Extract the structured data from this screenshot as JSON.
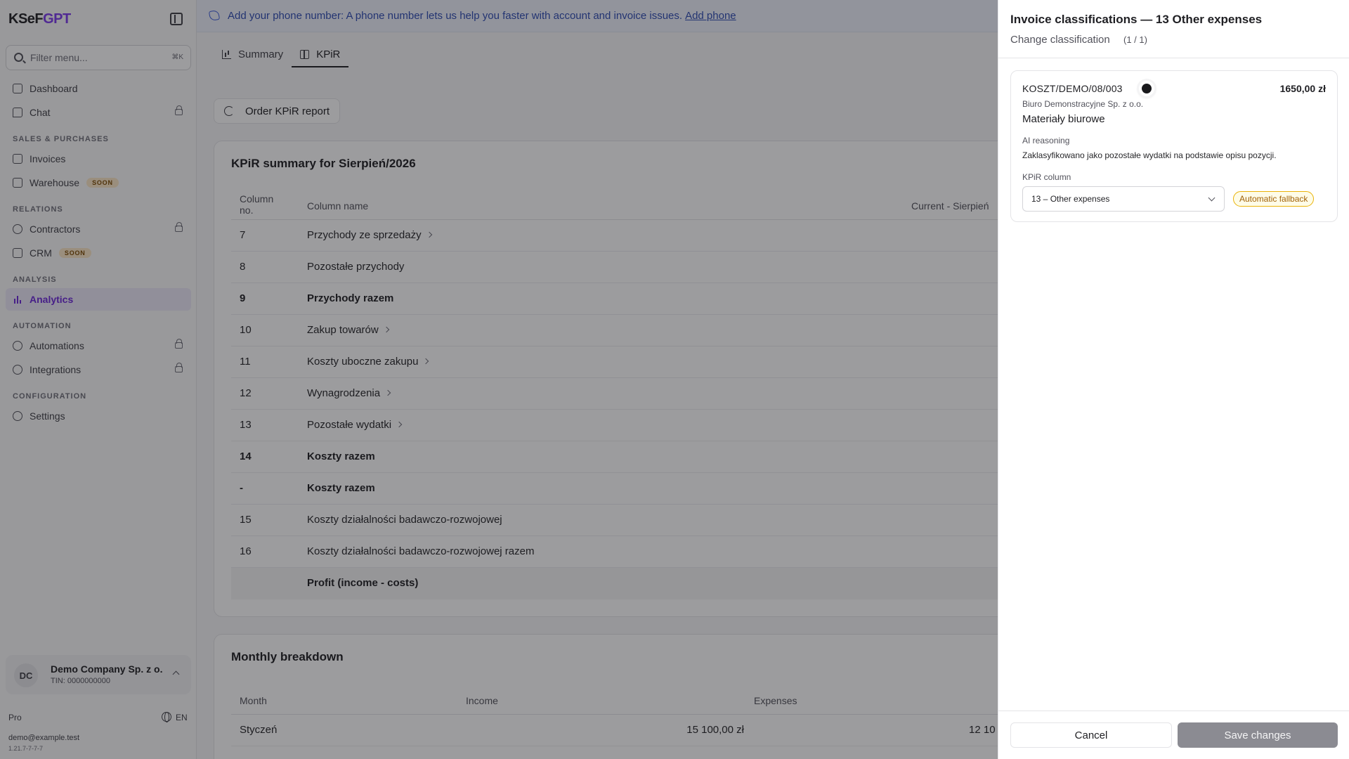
{
  "brand": {
    "prefix": "KSeF",
    "accent": "GPT"
  },
  "sidebar": {
    "filter_placeholder": "Filter menu...",
    "filter_shortcut": "⌘K",
    "items": {
      "dashboard": "Dashboard",
      "chat": "Chat",
      "invoices": "Invoices",
      "warehouse": "Warehouse",
      "contractors": "Contractors",
      "crm": "CRM",
      "analytics": "Analytics",
      "automations": "Automations",
      "integrations": "Integrations",
      "settings": "Settings"
    },
    "sections": {
      "sales": "Sales & Purchases",
      "relations": "Relations",
      "analysis": "Analysis",
      "automation": "Automation",
      "configuration": "Configuration"
    },
    "soon_badge": "SOON",
    "account": {
      "initials": "DC",
      "name": "Demo Company Sp. z o.o.",
      "tin": "TIN: 0000000000"
    },
    "plan": "Pro",
    "language": "EN",
    "email": "demo@example.test",
    "version": "1.21.7-7-7-7"
  },
  "banner": {
    "text": "Add your phone number: A phone number lets us help you faster with account and invoice issues.",
    "link": "Add phone"
  },
  "tabs": {
    "summary": "Summary",
    "kpir": "KPiR"
  },
  "order_button": "Order KPiR report",
  "kpir_summary": {
    "title": "KPiR summary for Sierpień/2026",
    "headers": {
      "no": "Column no.",
      "name": "Column name",
      "current": "Current - Sierpień"
    },
    "rows": [
      {
        "no": "7",
        "name": "Przychody ze sprzedaży"
      },
      {
        "no": "8",
        "name": "Pozostałe przychody"
      },
      {
        "no": "9",
        "name": "Przychody razem"
      },
      {
        "no": "10",
        "name": "Zakup towarów"
      },
      {
        "no": "11",
        "name": "Koszty uboczne zakupu"
      },
      {
        "no": "12",
        "name": "Wynagrodzenia"
      },
      {
        "no": "13",
        "name": "Pozostałe wydatki"
      },
      {
        "no": "14",
        "name": "Koszty razem"
      },
      {
        "no": "-",
        "name": "Koszty razem"
      },
      {
        "no": "15",
        "name": "Koszty działalności badawczo-rozwojowej"
      },
      {
        "no": "16",
        "name": "Koszty działalności badawczo-rozwojowej razem"
      },
      {
        "no": "",
        "name": "Profit (income - costs)"
      }
    ]
  },
  "monthly": {
    "title": "Monthly breakdown",
    "headers": {
      "month": "Month",
      "income": "Income",
      "expenses": "Expenses"
    },
    "rows": [
      {
        "month": "Styczeń",
        "income": "15 100,00 zł",
        "expenses": "12 10"
      }
    ]
  },
  "drawer": {
    "title": "Invoice classifications — 13 Other expenses",
    "subtitle": "Change classification",
    "count": "(1 / 1)",
    "invoice": {
      "number": "KOSZT/DEMO/08/003",
      "amount": "1650,00 zł",
      "vendor": "Biuro Demonstracyjne Sp. z o.o.",
      "description": "Materiały biurowe",
      "ai_label": "AI reasoning",
      "ai_text": "Zaklasyfikowano jako pozostałe wydatki na podstawie opisu pozycji.",
      "kpir_label": "KPiR column",
      "kpir_value": "13 – Other expenses",
      "badge": "Automatic fallback"
    },
    "cancel": "Cancel",
    "save": "Save changes"
  }
}
